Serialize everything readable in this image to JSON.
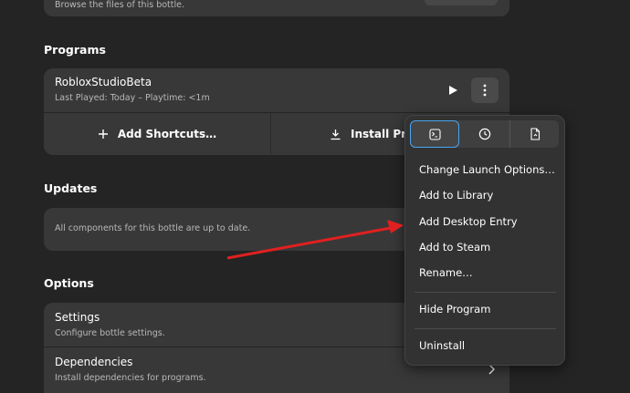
{
  "top_card": {
    "subtitle": "Browse the files of this bottle."
  },
  "programs": {
    "title": "Programs",
    "program": {
      "name": "RobloxStudioBeta",
      "meta": "Last Played: Today – Playtime: <1m"
    },
    "add_shortcuts_label": "Add Shortcuts…",
    "install_label": "Install Pro"
  },
  "updates": {
    "title": "Updates",
    "message": "All components for this bottle are up to date."
  },
  "options": {
    "title": "Options",
    "settings": {
      "title": "Settings",
      "subtitle": "Configure bottle settings."
    },
    "dependencies": {
      "title": "Dependencies",
      "subtitle": "Install dependencies for programs."
    }
  },
  "popover": {
    "tabs": [
      {
        "icon": "terminal-icon",
        "selected": true
      },
      {
        "icon": "clock-icon",
        "selected": false
      },
      {
        "icon": "file-icon",
        "selected": false
      }
    ],
    "items": [
      "Change Launch Options…",
      "Add to Library",
      "Add Desktop Entry",
      "Add to Steam",
      "Rename…",
      "Hide Program",
      "Uninstall"
    ]
  },
  "colors": {
    "background": "#242424",
    "card": "#383838",
    "accent": "#4aa3f0",
    "arrow": "#e02020"
  }
}
